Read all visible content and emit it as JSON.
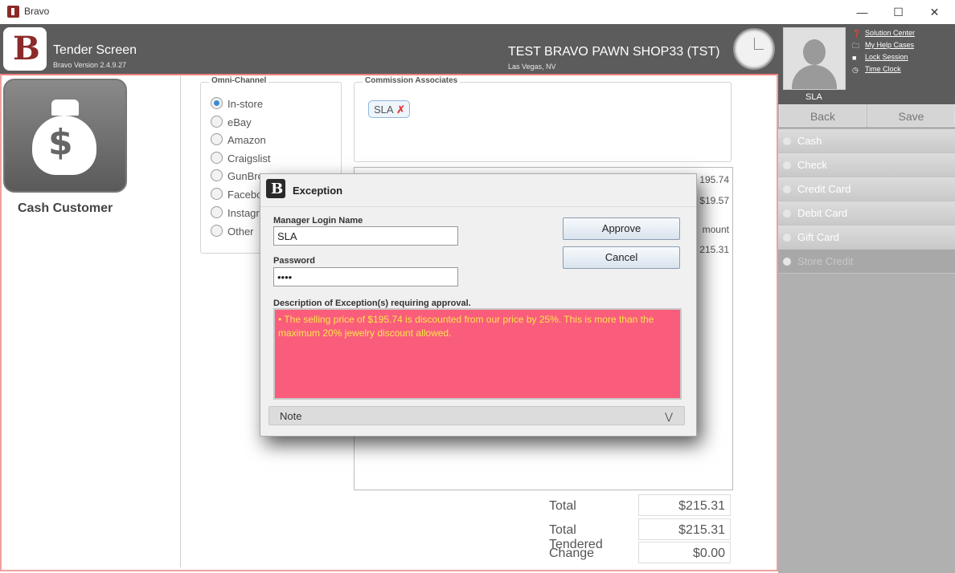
{
  "window": {
    "title": "Bravo"
  },
  "header": {
    "screen_title": "Tender Screen",
    "version": "Bravo Version 2.4.9.27",
    "shop_name": "TEST BRAVO PAWN SHOP33 (TST)",
    "city": "Las Vegas, NV"
  },
  "user": {
    "name": "SLA",
    "links": [
      "Solution Center",
      "My Help Cases",
      "Lock Session",
      "Time Clock"
    ]
  },
  "nav": {
    "back": "Back",
    "save": "Save"
  },
  "tenders": [
    "Cash",
    "Check",
    "Credit Card",
    "Debit Card",
    "Gift Card",
    "Store Credit"
  ],
  "customer": {
    "name": "Cash Customer"
  },
  "omni": {
    "label": "Omni-Channel",
    "options": [
      "In-store",
      "eBay",
      "Amazon",
      "Craigslist",
      "GunBro",
      "Facebo",
      "Instagr",
      "Other"
    ],
    "selected": "In-store"
  },
  "commission": {
    "label": "Commission Associates",
    "chip": "SLA"
  },
  "grid": {
    "v1": "195.74",
    "v2": "$19.57",
    "header": "mount",
    "v3": "215.31"
  },
  "totals": {
    "total_label": "Total",
    "total_value": "$215.31",
    "tendered_label": "Total Tendered",
    "tendered_value": "$215.31",
    "change_label": "Change",
    "change_value": "$0.00"
  },
  "dialog": {
    "title": "Exception",
    "manager_label": "Manager Login Name",
    "manager_value": "SLA",
    "password_label": "Password",
    "password_value": "••••",
    "approve": "Approve",
    "cancel": "Cancel",
    "desc_label": "Description of Exception(s) requiring approval.",
    "desc_text": "• The selling price of $195.74 is discounted from our price by 25%.  This is more than the maximum 20% jewelry discount allowed.",
    "note_label": "Note"
  },
  "colors": {
    "header": "#5c5c5c",
    "exception_bg": "#fa5d7b",
    "exception_text": "#f8e64a"
  }
}
